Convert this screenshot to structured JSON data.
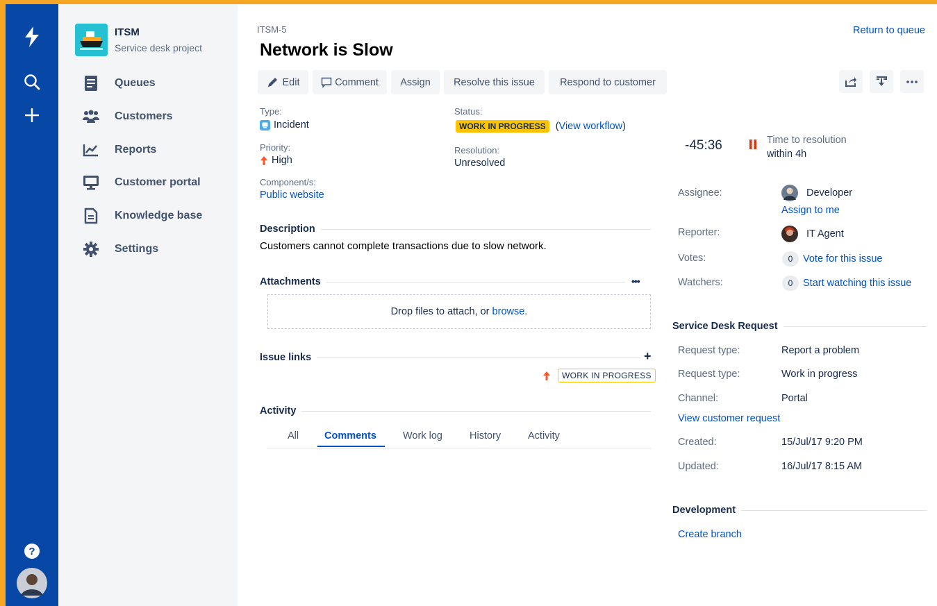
{
  "gnav": {
    "logo_icon": "jira-logo-icon",
    "search_icon": "search-icon",
    "create_icon": "plus-icon",
    "help_icon": "help-icon",
    "profile_icon": "user-avatar"
  },
  "project": {
    "name": "ITSM",
    "subtitle": "Service desk project",
    "avatar_icon": "ship-icon"
  },
  "sidebar": {
    "items": [
      {
        "label": "Queues",
        "icon": "queues-icon"
      },
      {
        "label": "Customers",
        "icon": "customers-icon"
      },
      {
        "label": "Reports",
        "icon": "reports-icon"
      },
      {
        "label": "Customer portal",
        "icon": "monitor-icon"
      },
      {
        "label": "Knowledge base",
        "icon": "document-icon"
      },
      {
        "label": "Settings",
        "icon": "gear-icon"
      }
    ]
  },
  "issue": {
    "key": "ITSM-5",
    "title": "Network is Slow",
    "return_link": "Return to queue"
  },
  "toolbar": {
    "edit": "Edit",
    "comment": "Comment",
    "assign": "Assign",
    "resolve": "Resolve this issue",
    "respond": "Respond to customer"
  },
  "details": {
    "type_label": "Type:",
    "type_value": "Incident",
    "priority_label": "Priority:",
    "priority_value": "High",
    "component_label": "Component/s:",
    "component_value": "Public website",
    "status_label": "Status:",
    "status_value": "WORK IN PROGRESS",
    "view_workflow_open": "(",
    "view_workflow": "View workflow",
    "view_workflow_close": ")",
    "resolution_label": "Resolution:",
    "resolution_value": "Unresolved"
  },
  "description": {
    "heading": "Description",
    "text": "Customers cannot complete transactions due to slow network."
  },
  "attachments": {
    "heading": "Attachments",
    "more": "•••",
    "drop_text": "Drop files to attach, or ",
    "browse": "browse."
  },
  "issue_links": {
    "heading": "Issue links",
    "add": "+",
    "status": "WORK IN PROGRESS"
  },
  "activity": {
    "heading": "Activity",
    "tabs": [
      "All",
      "Comments",
      "Work log",
      "History",
      "Activity"
    ],
    "active_tab": "Comments"
  },
  "sla": {
    "time": "-45:36",
    "label_line1": "Time to resolution",
    "label_line2": "within 4h"
  },
  "people": {
    "assignee_label": "Assignee:",
    "assignee": "Developer",
    "assign_to_me": "Assign to me",
    "reporter_label": "Reporter:",
    "reporter": "IT Agent",
    "votes_label": "Votes:",
    "votes_count": "0",
    "vote_link": "Vote for this issue",
    "watchers_label": "Watchers:",
    "watchers_count": "0",
    "watch_link": "Start watching this issue"
  },
  "service_desk": {
    "heading": "Service Desk Request",
    "request_type_label": "Request type:",
    "request_type_value": "Report a problem",
    "request_type2_label": "Request type:",
    "request_type2_value": "Work in progress",
    "channel_label": "Channel:",
    "channel_value": "Portal",
    "view_request": "View customer request",
    "created_label": "Created:",
    "created_value": "15/Jul/17 9:20 PM",
    "updated_label": "Updated:",
    "updated_value": "16/Jul/17 8:15 AM"
  },
  "development": {
    "heading": "Development",
    "create_branch": "Create branch"
  },
  "colors": {
    "frame": "#F6A623",
    "nav": "#0747A6",
    "link": "#0052CC",
    "lozenge_yellow": "#FFC400",
    "priority_red": "#FF5630",
    "sla_red": "#DE350B"
  }
}
